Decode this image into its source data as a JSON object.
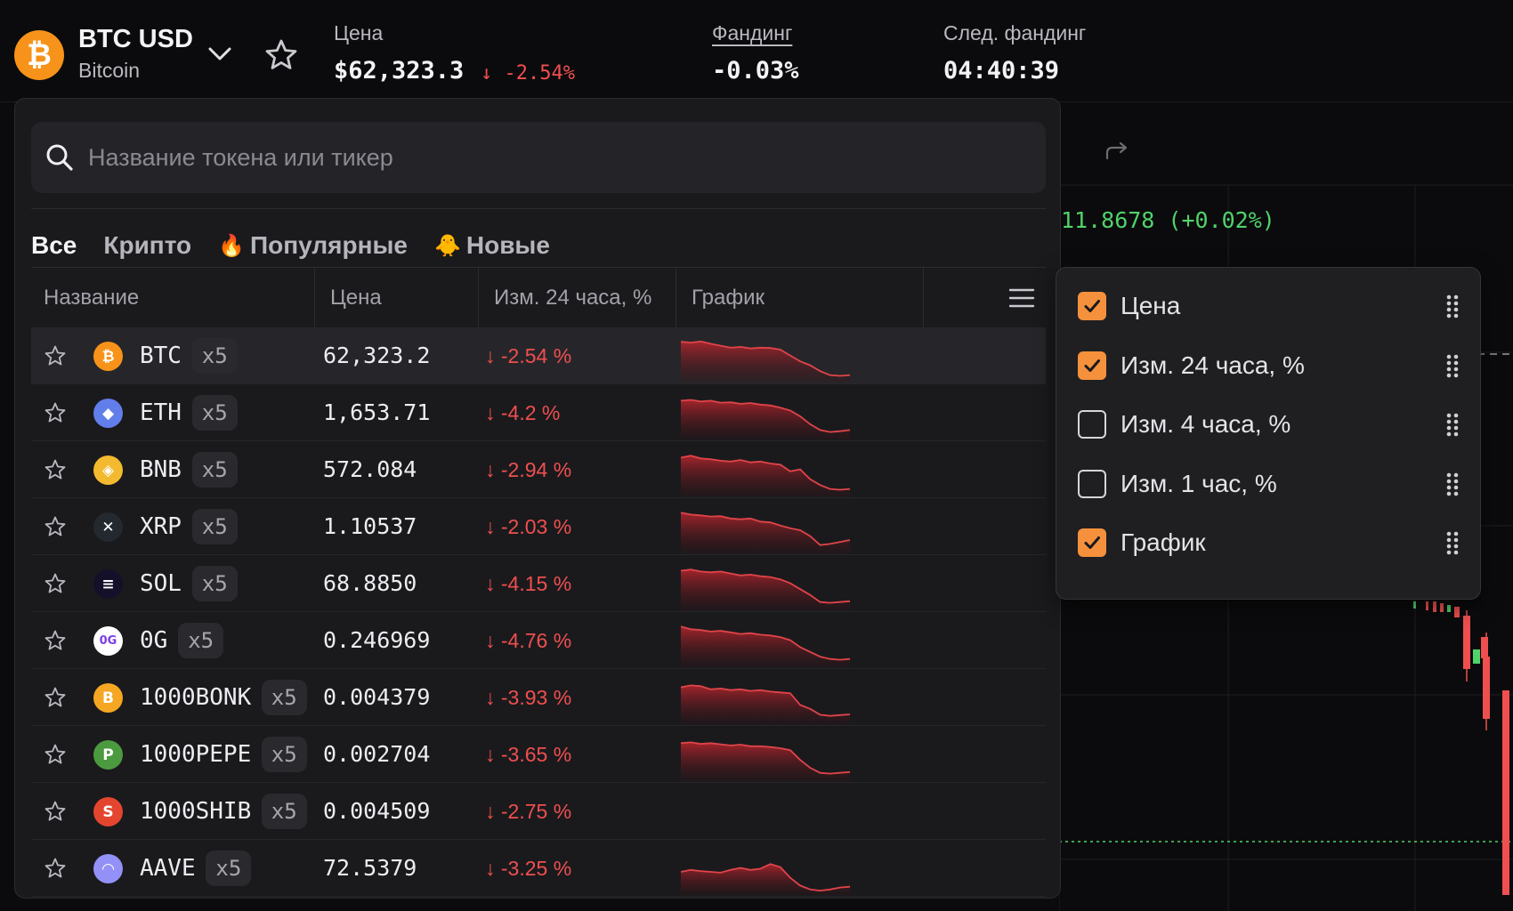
{
  "header": {
    "pair": "BTC USD",
    "name": "Bitcoin",
    "price_label": "Цена",
    "price": "$62,323.3",
    "change": "↓ -2.54%",
    "funding_label": "Фандинг",
    "funding": "-0.03%",
    "next_funding_label": "След. фандинг",
    "next_funding": "04:40:39"
  },
  "chart": {
    "price_readout": "11.8678 (+0.02%)"
  },
  "search": {
    "placeholder": "Название токена или тикер"
  },
  "tabs": [
    {
      "label": "Все",
      "emoji": "",
      "active": true
    },
    {
      "label": "Крипто",
      "emoji": "",
      "active": false
    },
    {
      "label": "Популярные",
      "emoji": "🔥",
      "active": false
    },
    {
      "label": "Новые",
      "emoji": "🐥",
      "active": false
    }
  ],
  "columns": {
    "name": "Название",
    "price": "Цена",
    "change": "Изм. 24 часа, %",
    "chart": "График"
  },
  "rows": [
    {
      "ticker": "BTC",
      "leverage": "x5",
      "price": "62,323.2",
      "change": "↓ -2.54 %",
      "icon": "bitcoin-icon",
      "color": "#f7931a",
      "glyph": "₿",
      "spark": [
        0.95,
        0.93,
        0.96,
        0.9,
        0.85,
        0.8,
        0.82,
        0.78,
        0.8,
        0.79,
        0.75,
        0.6,
        0.45,
        0.35,
        0.2,
        0.1,
        0.08,
        0.1
      ],
      "hover": true
    },
    {
      "ticker": "ETH",
      "leverage": "x5",
      "price": "1,653.71",
      "change": "↓ -4.2 %",
      "icon": "ethereum-icon",
      "color": "#627eea",
      "glyph": "◆",
      "spark": [
        0.9,
        0.92,
        0.88,
        0.9,
        0.85,
        0.86,
        0.82,
        0.84,
        0.8,
        0.78,
        0.72,
        0.65,
        0.5,
        0.3,
        0.15,
        0.1,
        0.12,
        0.15
      ],
      "hover": false
    },
    {
      "ticker": "BNB",
      "leverage": "x5",
      "price": "572.084",
      "change": "↓ -2.94 %",
      "icon": "bnb-icon",
      "color": "#f3ba2f",
      "glyph": "◈",
      "spark": [
        0.9,
        0.95,
        0.88,
        0.86,
        0.82,
        0.8,
        0.84,
        0.78,
        0.8,
        0.75,
        0.72,
        0.55,
        0.6,
        0.35,
        0.2,
        0.1,
        0.08,
        0.1
      ],
      "hover": false
    },
    {
      "ticker": "XRP",
      "leverage": "x5",
      "price": "1.10537",
      "change": "↓ -2.03 %",
      "icon": "xrp-icon",
      "color": "#23292f",
      "glyph": "✕",
      "spark": [
        0.95,
        0.9,
        0.88,
        0.85,
        0.86,
        0.8,
        0.78,
        0.8,
        0.72,
        0.7,
        0.62,
        0.55,
        0.5,
        0.35,
        0.12,
        0.15,
        0.2,
        0.25
      ],
      "hover": false
    },
    {
      "ticker": "SOL",
      "leverage": "x5",
      "price": "68.8850",
      "change": "↓ -4.15 %",
      "icon": "solana-icon",
      "color": "#14102a",
      "glyph": "≡",
      "spark": [
        0.92,
        0.95,
        0.9,
        0.88,
        0.9,
        0.85,
        0.8,
        0.82,
        0.78,
        0.76,
        0.7,
        0.6,
        0.45,
        0.3,
        0.12,
        0.1,
        0.12,
        0.14
      ],
      "hover": false
    },
    {
      "ticker": "0G",
      "leverage": "x5",
      "price": "0.246969",
      "change": "↓ -4.76 %",
      "icon": "zerog-icon",
      "color": "#ffffff",
      "glyph": "0G",
      "spark": [
        0.95,
        0.88,
        0.86,
        0.82,
        0.84,
        0.8,
        0.76,
        0.78,
        0.74,
        0.72,
        0.68,
        0.6,
        0.42,
        0.3,
        0.18,
        0.12,
        0.1,
        0.12
      ],
      "hover": false
    },
    {
      "ticker": "1000BONK",
      "leverage": "x5",
      "price": "0.004379",
      "change": "↓ -3.93 %",
      "icon": "bonk-icon",
      "color": "#f5a623",
      "glyph": "B",
      "spark": [
        0.85,
        0.9,
        0.88,
        0.8,
        0.82,
        0.78,
        0.8,
        0.76,
        0.78,
        0.74,
        0.72,
        0.7,
        0.4,
        0.3,
        0.15,
        0.12,
        0.14,
        0.16
      ],
      "hover": false
    },
    {
      "ticker": "1000PEPE",
      "leverage": "x5",
      "price": "0.002704",
      "change": "↓ -3.65 %",
      "icon": "pepe-icon",
      "color": "#4c9a3f",
      "glyph": "P",
      "spark": [
        0.88,
        0.9,
        0.86,
        0.88,
        0.85,
        0.82,
        0.84,
        0.8,
        0.8,
        0.78,
        0.75,
        0.7,
        0.45,
        0.25,
        0.12,
        0.1,
        0.12,
        0.14
      ],
      "hover": false
    },
    {
      "ticker": "1000SHIB",
      "leverage": "x5",
      "price": "0.004509",
      "change": "↓ -2.75 %",
      "icon": "shib-icon",
      "color": "#e4452f",
      "glyph": "S",
      "spark": [],
      "hover": false
    },
    {
      "ticker": "AAVE",
      "leverage": "x5",
      "price": "72.5379",
      "change": "↓ -3.25 %",
      "icon": "aave-icon",
      "color": "#9391f7",
      "glyph": "◠",
      "spark": [
        0.5,
        0.55,
        0.52,
        0.5,
        0.48,
        0.55,
        0.6,
        0.55,
        0.58,
        0.7,
        0.62,
        0.35,
        0.15,
        0.05,
        0.02,
        0.05,
        0.1,
        0.12
      ],
      "hover": false
    }
  ],
  "column_options": [
    {
      "label": "Цена",
      "checked": true
    },
    {
      "label": "Изм. 24 часа, %",
      "checked": true
    },
    {
      "label": "Изм. 4 часа, %",
      "checked": false
    },
    {
      "label": "Изм. 1 час, %",
      "checked": false
    },
    {
      "label": "График",
      "checked": true
    }
  ],
  "colors": {
    "accent": "#f5913c",
    "negative": "#ef4f4f",
    "positive": "#50d36a",
    "panel": "#1a1a1d"
  }
}
